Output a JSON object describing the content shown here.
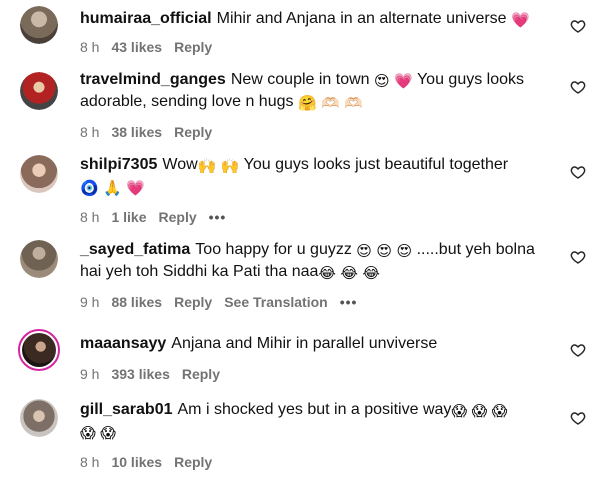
{
  "comments": [
    {
      "username": "humairaa_official",
      "text": "Mihir and Anjana in an alternate universe",
      "emoji": "💗",
      "time": "8 h",
      "likes": "43 likes",
      "reply": "Reply"
    },
    {
      "username": "travelmind_ganges",
      "text": "New couple in town",
      "emoji1": "😍",
      "emoji2": "💗",
      "text2": "You guys looks adorable, sending love n hugs",
      "emoji3": "🤗",
      "emoji4": "🫶🏻",
      "emoji5": "🫶🏻",
      "time": "8 h",
      "likes": "38 likes",
      "reply": "Reply"
    },
    {
      "username": "shilpi7305",
      "text": "Wow",
      "emoji1": "🙌",
      "emoji2": "🙌",
      "text2": "You guys looks just beautiful together",
      "emoji3": "🧿",
      "emoji4": "🙏",
      "emoji5": "💗",
      "time": "8 h",
      "likes": "1 like",
      "reply": "Reply",
      "more": "•••"
    },
    {
      "username": "_sayed_fatima",
      "text": "Too happy for u guyzz",
      "emoji1": "😍",
      "emoji2": "😍",
      "emoji3": "😍",
      "text2": ".....but yeh bolna hai yeh toh Siddhi ka Pati tha naa",
      "emoji4": "😂",
      "emoji5": "😂",
      "emoji6": "😂",
      "time": "9 h",
      "likes": "88 likes",
      "reply": "Reply",
      "translate": "See Translation",
      "more": "•••"
    },
    {
      "username": "maaansayy",
      "text": "Anjana and Mihir in parallel unviverse",
      "time": "9 h",
      "likes": "393 likes",
      "reply": "Reply"
    },
    {
      "username": "gill_sarab01",
      "text": "Am i shocked yes but in a positive way",
      "emoji1": "😱",
      "emoji2": "😱",
      "emoji3": "😱",
      "emoji4": "😱",
      "emoji5": "😱",
      "time": "8 h",
      "likes": "10 likes",
      "reply": "Reply"
    }
  ],
  "colors": {
    "meta": "#737373",
    "story_ring": "#d6249f"
  }
}
